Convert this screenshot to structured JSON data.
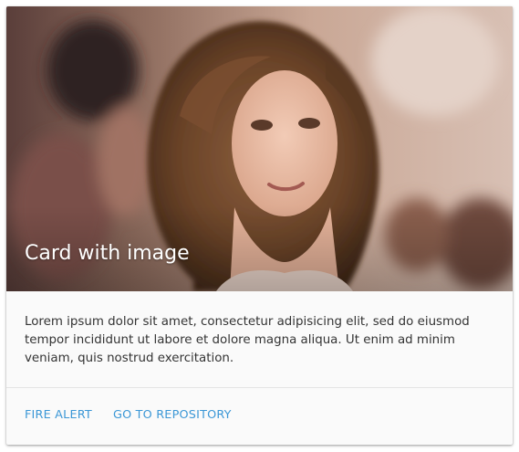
{
  "card": {
    "title": "Card with image",
    "body": "Lorem ipsum dolor sit amet, consectetur adipisicing elit, sed do eiusmod tempor incididunt ut labore et dolore magna aliqua. Ut enim ad minim veniam, quis nostrud exercitation.",
    "actions": [
      {
        "label": "FIRE ALERT"
      },
      {
        "label": "GO TO REPOSITORY"
      }
    ]
  },
  "colors": {
    "link": "#3b97d6",
    "card_background": "#fafafa",
    "text": "#333333",
    "title": "#ffffff"
  }
}
